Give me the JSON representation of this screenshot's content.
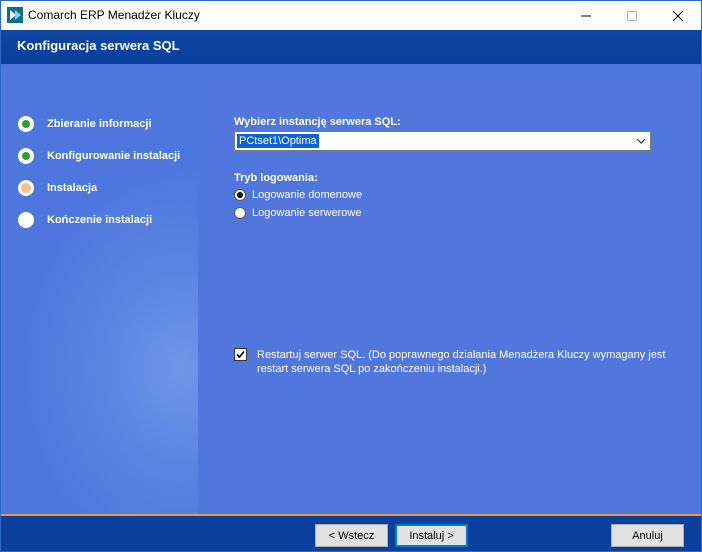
{
  "window": {
    "title": "Comarch ERP Menadżer Kluczy"
  },
  "header": {
    "title": "Konfiguracja serwera SQL"
  },
  "steps": [
    {
      "label": "Zbieranie informacji",
      "state": "done"
    },
    {
      "label": "Konfigurowanie instalacji",
      "state": "done"
    },
    {
      "label": "Instalacja",
      "state": "current"
    },
    {
      "label": "Kończenie instalacji",
      "state": "pending"
    }
  ],
  "form": {
    "instance_label": "Wybierz instancję serwera SQL:",
    "instance_value": "PCtset1\\Optima",
    "login_mode_label": "Tryb logowania:",
    "login_options": [
      {
        "label": "Logowanie domenowe",
        "selected": true
      },
      {
        "label": "Logowanie serwerowe",
        "selected": false
      }
    ],
    "restart_checked": true,
    "restart_label": "Restartuj serwer SQL. (Do poprawnego działania Menadżera Kluczy wymagany jest restart serwera SQL po zakończeniu instalacji.)"
  },
  "buttons": {
    "back": "< Wstecz",
    "install": "Instaluj >",
    "cancel": "Anuluj"
  },
  "colors": {
    "panel": "#5177dc",
    "header": "#0a3f9c",
    "accent": "#e89a3c",
    "done": "#2aa12e",
    "current": "#f5c08b"
  },
  "icons": [
    "app-logo-icon",
    "minimize-icon",
    "maximize-icon",
    "close-icon",
    "chevron-down-icon",
    "checkmark-icon"
  ]
}
